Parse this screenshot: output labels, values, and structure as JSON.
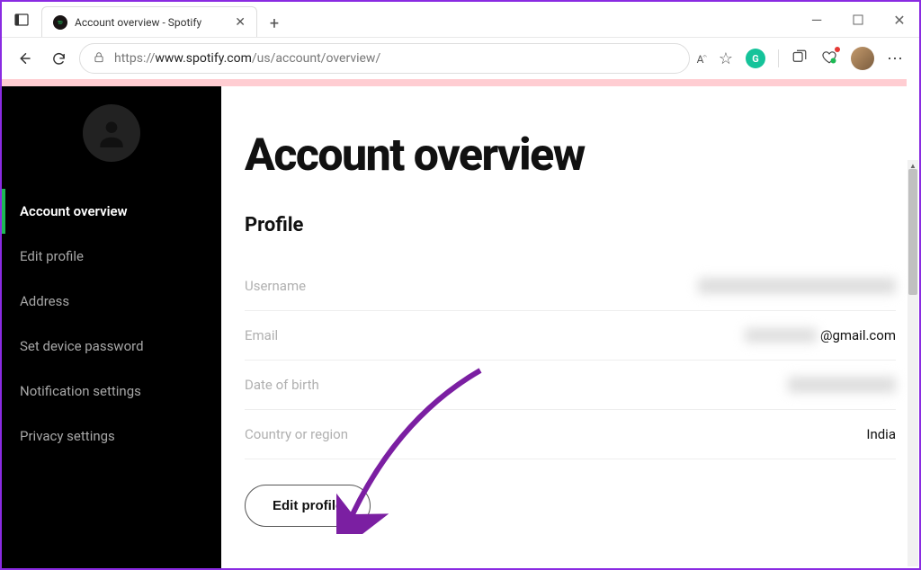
{
  "browser": {
    "tab_title": "Account overview - Spotify",
    "url_display": "https://www.spotify.com/us/account/overview/",
    "url_prefix": "https://",
    "url_host": "www.spotify.com",
    "url_path": "/us/account/overview/"
  },
  "sidebar": {
    "items": [
      {
        "label": "Account overview",
        "active": true
      },
      {
        "label": "Edit profile",
        "active": false
      },
      {
        "label": "Address",
        "active": false
      },
      {
        "label": "Set device password",
        "active": false
      },
      {
        "label": "Notification settings",
        "active": false
      },
      {
        "label": "Privacy settings",
        "active": false
      }
    ]
  },
  "main": {
    "title": "Account overview",
    "section": "Profile",
    "rows": {
      "username_label": "Username",
      "email_label": "Email",
      "email_suffix": "@gmail.com",
      "dob_label": "Date of birth",
      "country_label": "Country or region",
      "country_value": "India"
    },
    "edit_button": "Edit profile"
  },
  "icons": {
    "back": "←",
    "refresh": "⟳",
    "close": "✕",
    "plus": "+",
    "min": "—",
    "max": "▢",
    "winclose": "✕",
    "star": "☆",
    "more": "⋯",
    "textA": "A⁸",
    "collections": "❐"
  }
}
